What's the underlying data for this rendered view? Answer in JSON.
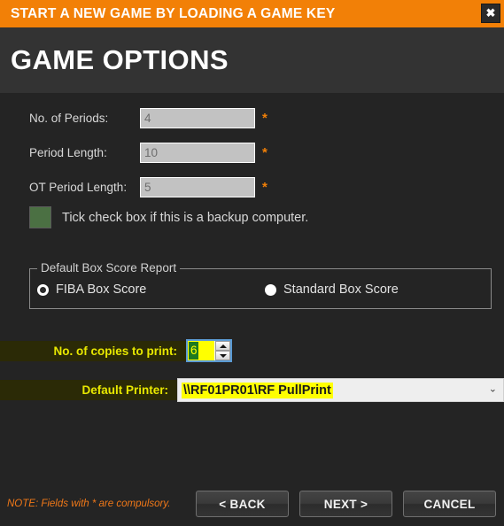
{
  "window": {
    "title": "START A NEW GAME BY LOADING A GAME KEY",
    "close_icon": "✖",
    "accent_color": "#f28007"
  },
  "heading": {
    "title": "GAME OPTIONS"
  },
  "fields": [
    {
      "label": "No. of Periods:",
      "value": "4",
      "required_mark": "*"
    },
    {
      "label": "Period Length:",
      "value": "10",
      "required_mark": "*"
    },
    {
      "label": "OT Period Length:",
      "value": "5",
      "required_mark": "*"
    }
  ],
  "backup_checkbox": {
    "label": "Tick check box if this is a backup computer.",
    "checked_color": "#4b7043"
  },
  "box_score": {
    "legend": "Default Box Score Report",
    "options": [
      {
        "label": "FIBA Box Score",
        "selected": true
      },
      {
        "label": "Standard Box Score",
        "selected": false
      }
    ]
  },
  "copies": {
    "label": "No. of copies to print:",
    "value": "6",
    "highlight_color": "#ffff00",
    "selection_color": "#1f7a1f"
  },
  "printer": {
    "label": "Default Printer:",
    "value": "\\\\RF01PR01\\RF PullPrint",
    "chevron_icon": "⌄",
    "highlight_color": "#ffff00"
  },
  "footer": {
    "note": "NOTE: Fields with * are compulsory.",
    "note_color": "#f07818",
    "buttons": [
      {
        "label": "< BACK"
      },
      {
        "label": "NEXT >"
      },
      {
        "label": "CANCEL"
      }
    ]
  }
}
